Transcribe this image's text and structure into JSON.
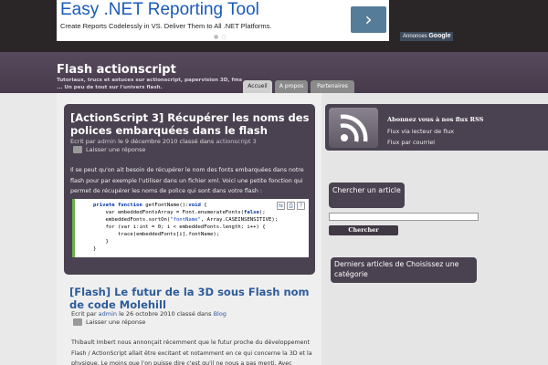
{
  "ad": {
    "title": "Easy .NET Reporting Tool",
    "text": "Create Reports Codelessly in VS. Deliver Them to All .NET Platforms.",
    "arrow": "›",
    "dots": "●○",
    "credit_prefix": "Annonces ",
    "credit_brand": "Google"
  },
  "site": {
    "title": "Flash actionscript",
    "description": "Tutoriaux, trucs et astuces sur actionscript, papervision 3D, fms ... Un peu de tout sur l'univers flash."
  },
  "nav": {
    "tabs": [
      {
        "label": "Accueil"
      },
      {
        "label": "A propos"
      },
      {
        "label": "Partenaires"
      }
    ]
  },
  "posts": [
    {
      "title": "[ActionScript 3] Récupérer les noms des polices embarquées dans le flash",
      "meta_prefix": "Ecrit par ",
      "author": "admin",
      "meta_mid": " le 9 décembre 2010 classé dans ",
      "category": "actionscript 3",
      "comments": "Laisser une réponse",
      "body": "Il se peut qu'on ait besoin de récupérer le nom des fonts embarquées dans notre flash pour par exemple l'utiliser dans un fichier xml. Voici une petite fonction qui permet de récupérer les noms de police qui sont dans votre flash :"
    },
    {
      "title": "[Flash] Le futur de la 3D sous Flash nom de code Molehill",
      "meta_prefix": "Ecrit par ",
      "author": "admin",
      "meta_mid": " le 26 octobre 2010 classé dans ",
      "category": "Blog",
      "comments": "Laisser une réponse",
      "body": "Thibault Imbert nous annonçait récemment que le futur proche du développement Flash / ActionScript allait être excitant et notamment en ce qui concerne la 3D et la physique. Le moins que l'on puisse dire c'est qu'il ne nous a pas menti. Avec"
    }
  ],
  "code": {
    "lines": [
      [
        "private function ",
        "getFontName",
        "():",
        "void",
        " {"
      ],
      [
        "    var embeddedFontsArray = Font.enumerateFonts(",
        "false",
        ");"
      ],
      [
        "    embeddedFonts.sortOn(",
        "\"fontName\"",
        ", Array.CASEINSENSITIVE);"
      ],
      [
        ""
      ],
      [
        "    for (var i:int = 0; i < embeddedFonts.length; i++) {"
      ],
      [
        "        trace(embeddedFonts[i].fontName);"
      ],
      [
        "    }"
      ],
      [
        "}"
      ]
    ],
    "tools": [
      "⇆",
      "⎙",
      "?"
    ]
  },
  "sidebar": {
    "rss": {
      "heading": "Abonnez vous à nos flux RSS",
      "links": [
        "Flux via lecteur de flux",
        "Flux par courriel"
      ]
    },
    "search": {
      "title": "Chercher un article",
      "button": "Chercher",
      "value": ""
    },
    "derniers": {
      "title": "Derniers articles de Choisissez une catégorie"
    }
  },
  "colors": {
    "accent": "#4a4250",
    "link": "#2e5c9a",
    "ad_link": "#1a5ab8"
  }
}
